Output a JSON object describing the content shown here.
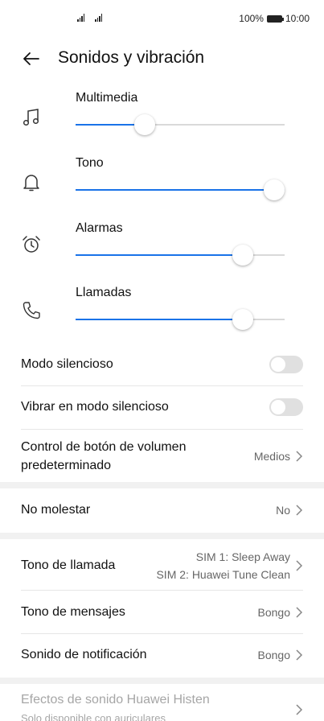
{
  "status_bar": {
    "battery_percent": "100%",
    "time": "10:00"
  },
  "header": {
    "title": "Sonidos y vibración"
  },
  "volumes": [
    {
      "label": "Multimedia",
      "icon": "music-note-icon",
      "level": 0.33
    },
    {
      "label": "Tono",
      "icon": "bell-icon",
      "level": 1.0
    },
    {
      "label": "Alarmas",
      "icon": "alarm-clock-icon",
      "level": 0.8
    },
    {
      "label": "Llamadas",
      "icon": "phone-icon",
      "level": 0.8
    }
  ],
  "settings": {
    "silent_mode": {
      "label": "Modo silencioso",
      "on": false
    },
    "vibrate_silent": {
      "label": "Vibrar en modo silencioso",
      "on": false
    },
    "volume_button": {
      "label_line1": "Control de botón de volumen",
      "label_line2": "predeterminado",
      "value": "Medios"
    },
    "do_not_disturb": {
      "label": "No molestar",
      "value": "No"
    },
    "ringtone": {
      "label": "Tono de llamada",
      "sim1": "SIM 1: Sleep Away",
      "sim2": "SIM 2: Huawei Tune Clean"
    },
    "message_tone": {
      "label": "Tono de mensajes",
      "value": "Bongo"
    },
    "notification_sound": {
      "label": "Sonido de notificación",
      "value": "Bongo"
    },
    "histen": {
      "label": "Efectos de sonido Huawei Histen",
      "subtitle": "Solo disponible con auriculares"
    }
  },
  "colors": {
    "accent": "#1a73e8"
  }
}
